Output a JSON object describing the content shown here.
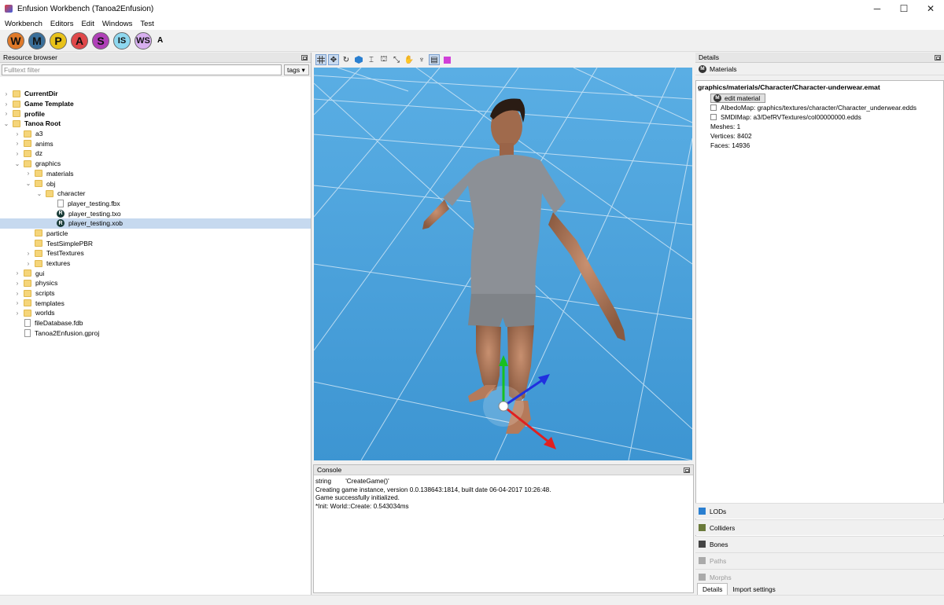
{
  "window": {
    "title": "Enfusion Workbench (Tanoa2Enfusion)"
  },
  "menu": [
    "Workbench",
    "Editors",
    "Edit",
    "Windows",
    "Test"
  ],
  "toolbar": {
    "modules": [
      {
        "letter": "W",
        "color": "#e07a2a"
      },
      {
        "letter": "M",
        "color": "#3a6f9a"
      },
      {
        "letter": "P",
        "color": "#e8c21a"
      },
      {
        "letter": "A",
        "color": "#e0484a"
      },
      {
        "letter": "S",
        "color": "#b040b8"
      },
      {
        "letter": "IS",
        "color": "#8ed8f0"
      },
      {
        "letter": "WS",
        "color": "#d8b0f0"
      }
    ],
    "extra": "A"
  },
  "resource_browser": {
    "title": "Resource browser",
    "filter_placeholder": "Fulltext filter",
    "tags_label": "tags",
    "items": [
      {
        "label": "CurrentDir",
        "depth": 0,
        "type": "folder",
        "arrow": "›",
        "bold": true
      },
      {
        "label": "Game Template",
        "depth": 0,
        "type": "folder",
        "arrow": "›",
        "bold": true
      },
      {
        "label": "profile",
        "depth": 0,
        "type": "folder",
        "arrow": "›",
        "bold": true
      },
      {
        "label": "Tanoa Root",
        "depth": 0,
        "type": "folder",
        "arrow": "⌄",
        "bold": true
      },
      {
        "label": "a3",
        "depth": 1,
        "type": "folder",
        "arrow": "›"
      },
      {
        "label": "anims",
        "depth": 1,
        "type": "folder",
        "arrow": "›"
      },
      {
        "label": "dz",
        "depth": 1,
        "type": "folder",
        "arrow": "›"
      },
      {
        "label": "graphics",
        "depth": 1,
        "type": "folder",
        "arrow": "⌄"
      },
      {
        "label": "materials",
        "depth": 2,
        "type": "folder",
        "arrow": "›"
      },
      {
        "label": "obj",
        "depth": 2,
        "type": "folder",
        "arrow": "⌄"
      },
      {
        "label": "character",
        "depth": 3,
        "type": "folder",
        "arrow": "⌄"
      },
      {
        "label": "player_testing.fbx",
        "depth": 4,
        "type": "file",
        "arrow": ""
      },
      {
        "label": "player_testing.txo",
        "depth": 4,
        "type": "resource",
        "arrow": ""
      },
      {
        "label": "player_testing.xob",
        "depth": 4,
        "type": "resource",
        "arrow": "",
        "selected": true
      },
      {
        "label": "particle",
        "depth": 2,
        "type": "folder",
        "arrow": ""
      },
      {
        "label": "TestSimplePBR",
        "depth": 2,
        "type": "folder",
        "arrow": ""
      },
      {
        "label": "TestTextures",
        "depth": 2,
        "type": "folder",
        "arrow": "›"
      },
      {
        "label": "textures",
        "depth": 2,
        "type": "folder",
        "arrow": "›"
      },
      {
        "label": "gui",
        "depth": 1,
        "type": "folder",
        "arrow": "›"
      },
      {
        "label": "physics",
        "depth": 1,
        "type": "folder",
        "arrow": "›"
      },
      {
        "label": "scripts",
        "depth": 1,
        "type": "folder",
        "arrow": "›"
      },
      {
        "label": "templates",
        "depth": 1,
        "type": "folder",
        "arrow": "›"
      },
      {
        "label": "worlds",
        "depth": 1,
        "type": "folder",
        "arrow": "›"
      },
      {
        "label": "fileDatabase.fdb",
        "depth": 1,
        "type": "file",
        "arrow": ""
      },
      {
        "label": "Tanoa2Enfusion.gproj",
        "depth": 1,
        "type": "file",
        "arrow": ""
      }
    ]
  },
  "console": {
    "title": "Console",
    "lines": [
      "string        'CreateGame()'",
      "Creating game instance, version 0.0.138643:1814, built date 06-04-2017 10:26:48.",
      "Game successfully initialized.",
      "*Init: World::Create: 0.543034ms"
    ]
  },
  "details": {
    "title": "Details",
    "section": "Materials",
    "material_path": "graphics/materials/Character/Character-underwear.emat",
    "edit_label": "edit material",
    "maps": [
      "AlbedoMap: graphics/textures/character/Character_underwear.edds",
      "SMDIMap: a3/DefRVTextures/col00000000.edds"
    ],
    "stats": [
      "Meshes: 1",
      "Vertices: 8402",
      "Faces: 14936"
    ],
    "sections": [
      {
        "label": "LODs",
        "color": "#2a7fd0",
        "enabled": true
      },
      {
        "label": "Colliders",
        "color": "#6a7a3a",
        "enabled": true
      },
      {
        "label": "Bones",
        "color": "#444444",
        "enabled": true
      },
      {
        "label": "Paths",
        "color": "#aaaaaa",
        "enabled": false
      },
      {
        "label": "Morphs",
        "color": "#aaaaaa",
        "enabled": false
      }
    ],
    "tabs": [
      "Details",
      "Import settings"
    ]
  }
}
